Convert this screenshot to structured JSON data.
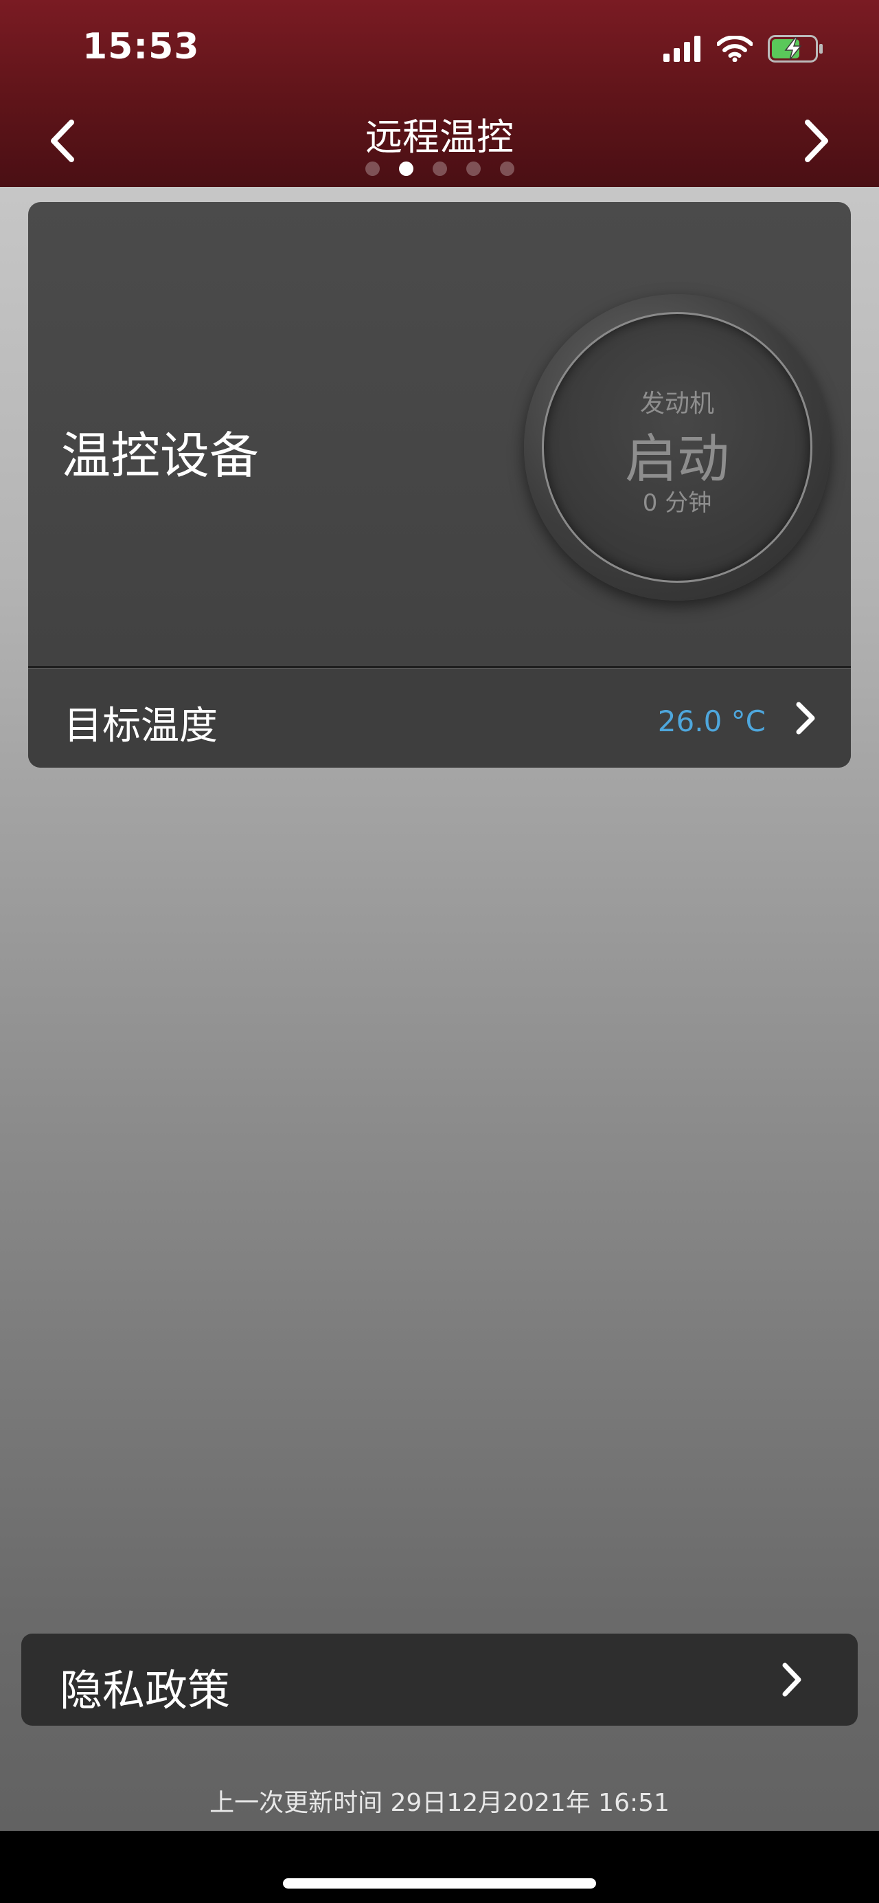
{
  "status_bar": {
    "time": "15:53",
    "icons": [
      "signal-icon",
      "wifi-icon",
      "battery-charging-icon"
    ],
    "battery_color": "#5ac85a"
  },
  "nav": {
    "title": "远程温控",
    "back_icon": "chevron-left-icon",
    "forward_icon": "chevron-right-icon",
    "page_count": 5,
    "active_page": 2
  },
  "device_card": {
    "title": "温控设备",
    "engine": {
      "label": "发动机",
      "state": "启动",
      "minutes": "0 分钟"
    },
    "target_temp": {
      "label": "目标温度",
      "value": "26.0 °C",
      "value_color": "#4ea7dd"
    }
  },
  "privacy": {
    "label": "隐私政策"
  },
  "footer": {
    "last_update": "上一次更新时间 29日12月2021年 16:51"
  },
  "colors": {
    "header": "#5e1419",
    "card": "#444444",
    "privacy_row": "#2e2e2e"
  }
}
